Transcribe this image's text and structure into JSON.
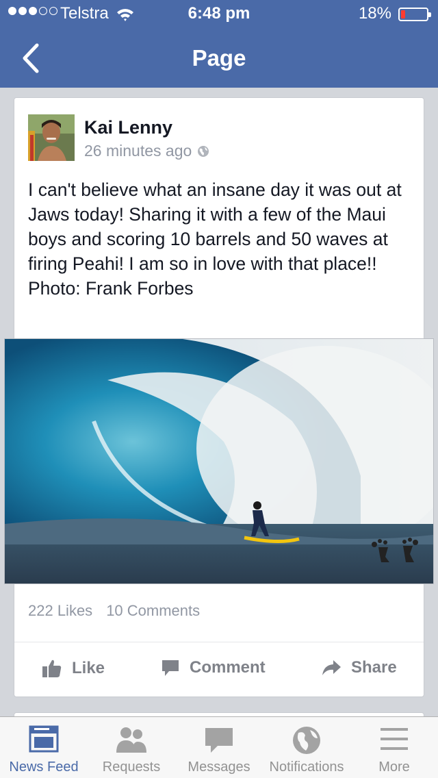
{
  "status_bar": {
    "carrier": "Telstra",
    "time": "6:48 pm",
    "battery_percent": "18%",
    "battery_level": 0.18
  },
  "nav": {
    "title": "Page",
    "back_icon": "chevron-left-icon"
  },
  "post": {
    "author": "Kai Lenny",
    "time_ago": "26 minutes ago",
    "privacy_icon": "globe-icon",
    "text": "I can't believe what an insane day it was out at Jaws today! Sharing it with a few of the Maui boys and scoring 10 barrels and 50 waves at firing Peahi! I am so in love with that place!!\nPhoto: Frank Forbes",
    "likes": "222 Likes",
    "comments": "10 Comments",
    "actions": {
      "like": "Like",
      "comment": "Comment",
      "share": "Share"
    }
  },
  "tabbar": {
    "items": [
      {
        "label": "News Feed",
        "icon": "news-feed-icon",
        "active": true
      },
      {
        "label": "Requests",
        "icon": "requests-icon",
        "active": false
      },
      {
        "label": "Messages",
        "icon": "messages-icon",
        "active": false
      },
      {
        "label": "Notifications",
        "icon": "globe-icon",
        "active": false
      },
      {
        "label": "More",
        "icon": "menu-icon",
        "active": false
      }
    ]
  },
  "colors": {
    "brand": "#4a6aa8",
    "background": "#d3d6db",
    "inactive": "#929292",
    "battery_low": "#ff3b30"
  }
}
